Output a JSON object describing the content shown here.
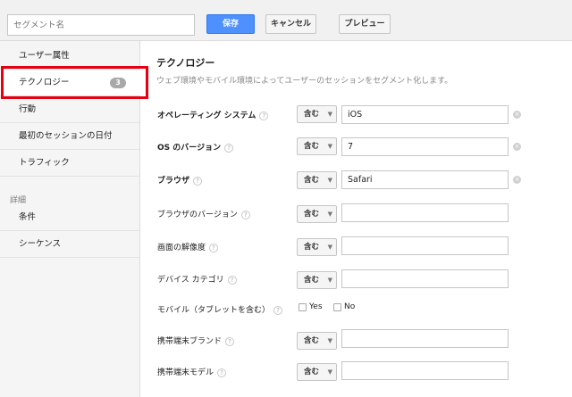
{
  "toolbar": {
    "segment_name_placeholder": "セグメント名",
    "save_label": "保存",
    "cancel_label": "キャンセル",
    "preview_label": "プレビュー"
  },
  "sidebar": {
    "items": [
      {
        "label": "ユーザー属性"
      },
      {
        "label": "テクノロジー",
        "count": "3"
      },
      {
        "label": "行動"
      },
      {
        "label": "最初のセッションの日付"
      },
      {
        "label": "トラフィック"
      }
    ],
    "advanced_heading": "詳細",
    "advanced_items": [
      {
        "label": "条件"
      },
      {
        "label": "シーケンス"
      }
    ]
  },
  "main": {
    "title": "テクノロジー",
    "description": "ウェブ環境やモバイル環境によってユーザーのセッションをセグメント化します。",
    "rows": [
      {
        "label": "オペレーティング システム",
        "operator": "含む",
        "value": "iOS"
      },
      {
        "label": "OS のバージョン",
        "operator": "含む",
        "value": "7"
      },
      {
        "label": "ブラウザ",
        "operator": "含む",
        "value": "Safari"
      },
      {
        "label": "ブラウザのバージョン",
        "operator": "含む",
        "value": ""
      },
      {
        "label": "画面の解像度",
        "operator": "含む",
        "value": ""
      },
      {
        "label": "デバイス カテゴリ",
        "operator": "含む",
        "value": ""
      },
      {
        "label": "携帯端末ブランド",
        "operator": "含む",
        "value": ""
      },
      {
        "label": "携帯端末モデル",
        "operator": "含む",
        "value": ""
      }
    ],
    "mobile": {
      "label": "モバイル（タブレットを含む）",
      "yes_label": "Yes",
      "no_label": "No"
    }
  },
  "icons": {
    "help": "?",
    "caret": "▼",
    "clear": "×"
  },
  "colors": {
    "save_button": "#4d90fe",
    "highlight_border": "#e60012"
  }
}
